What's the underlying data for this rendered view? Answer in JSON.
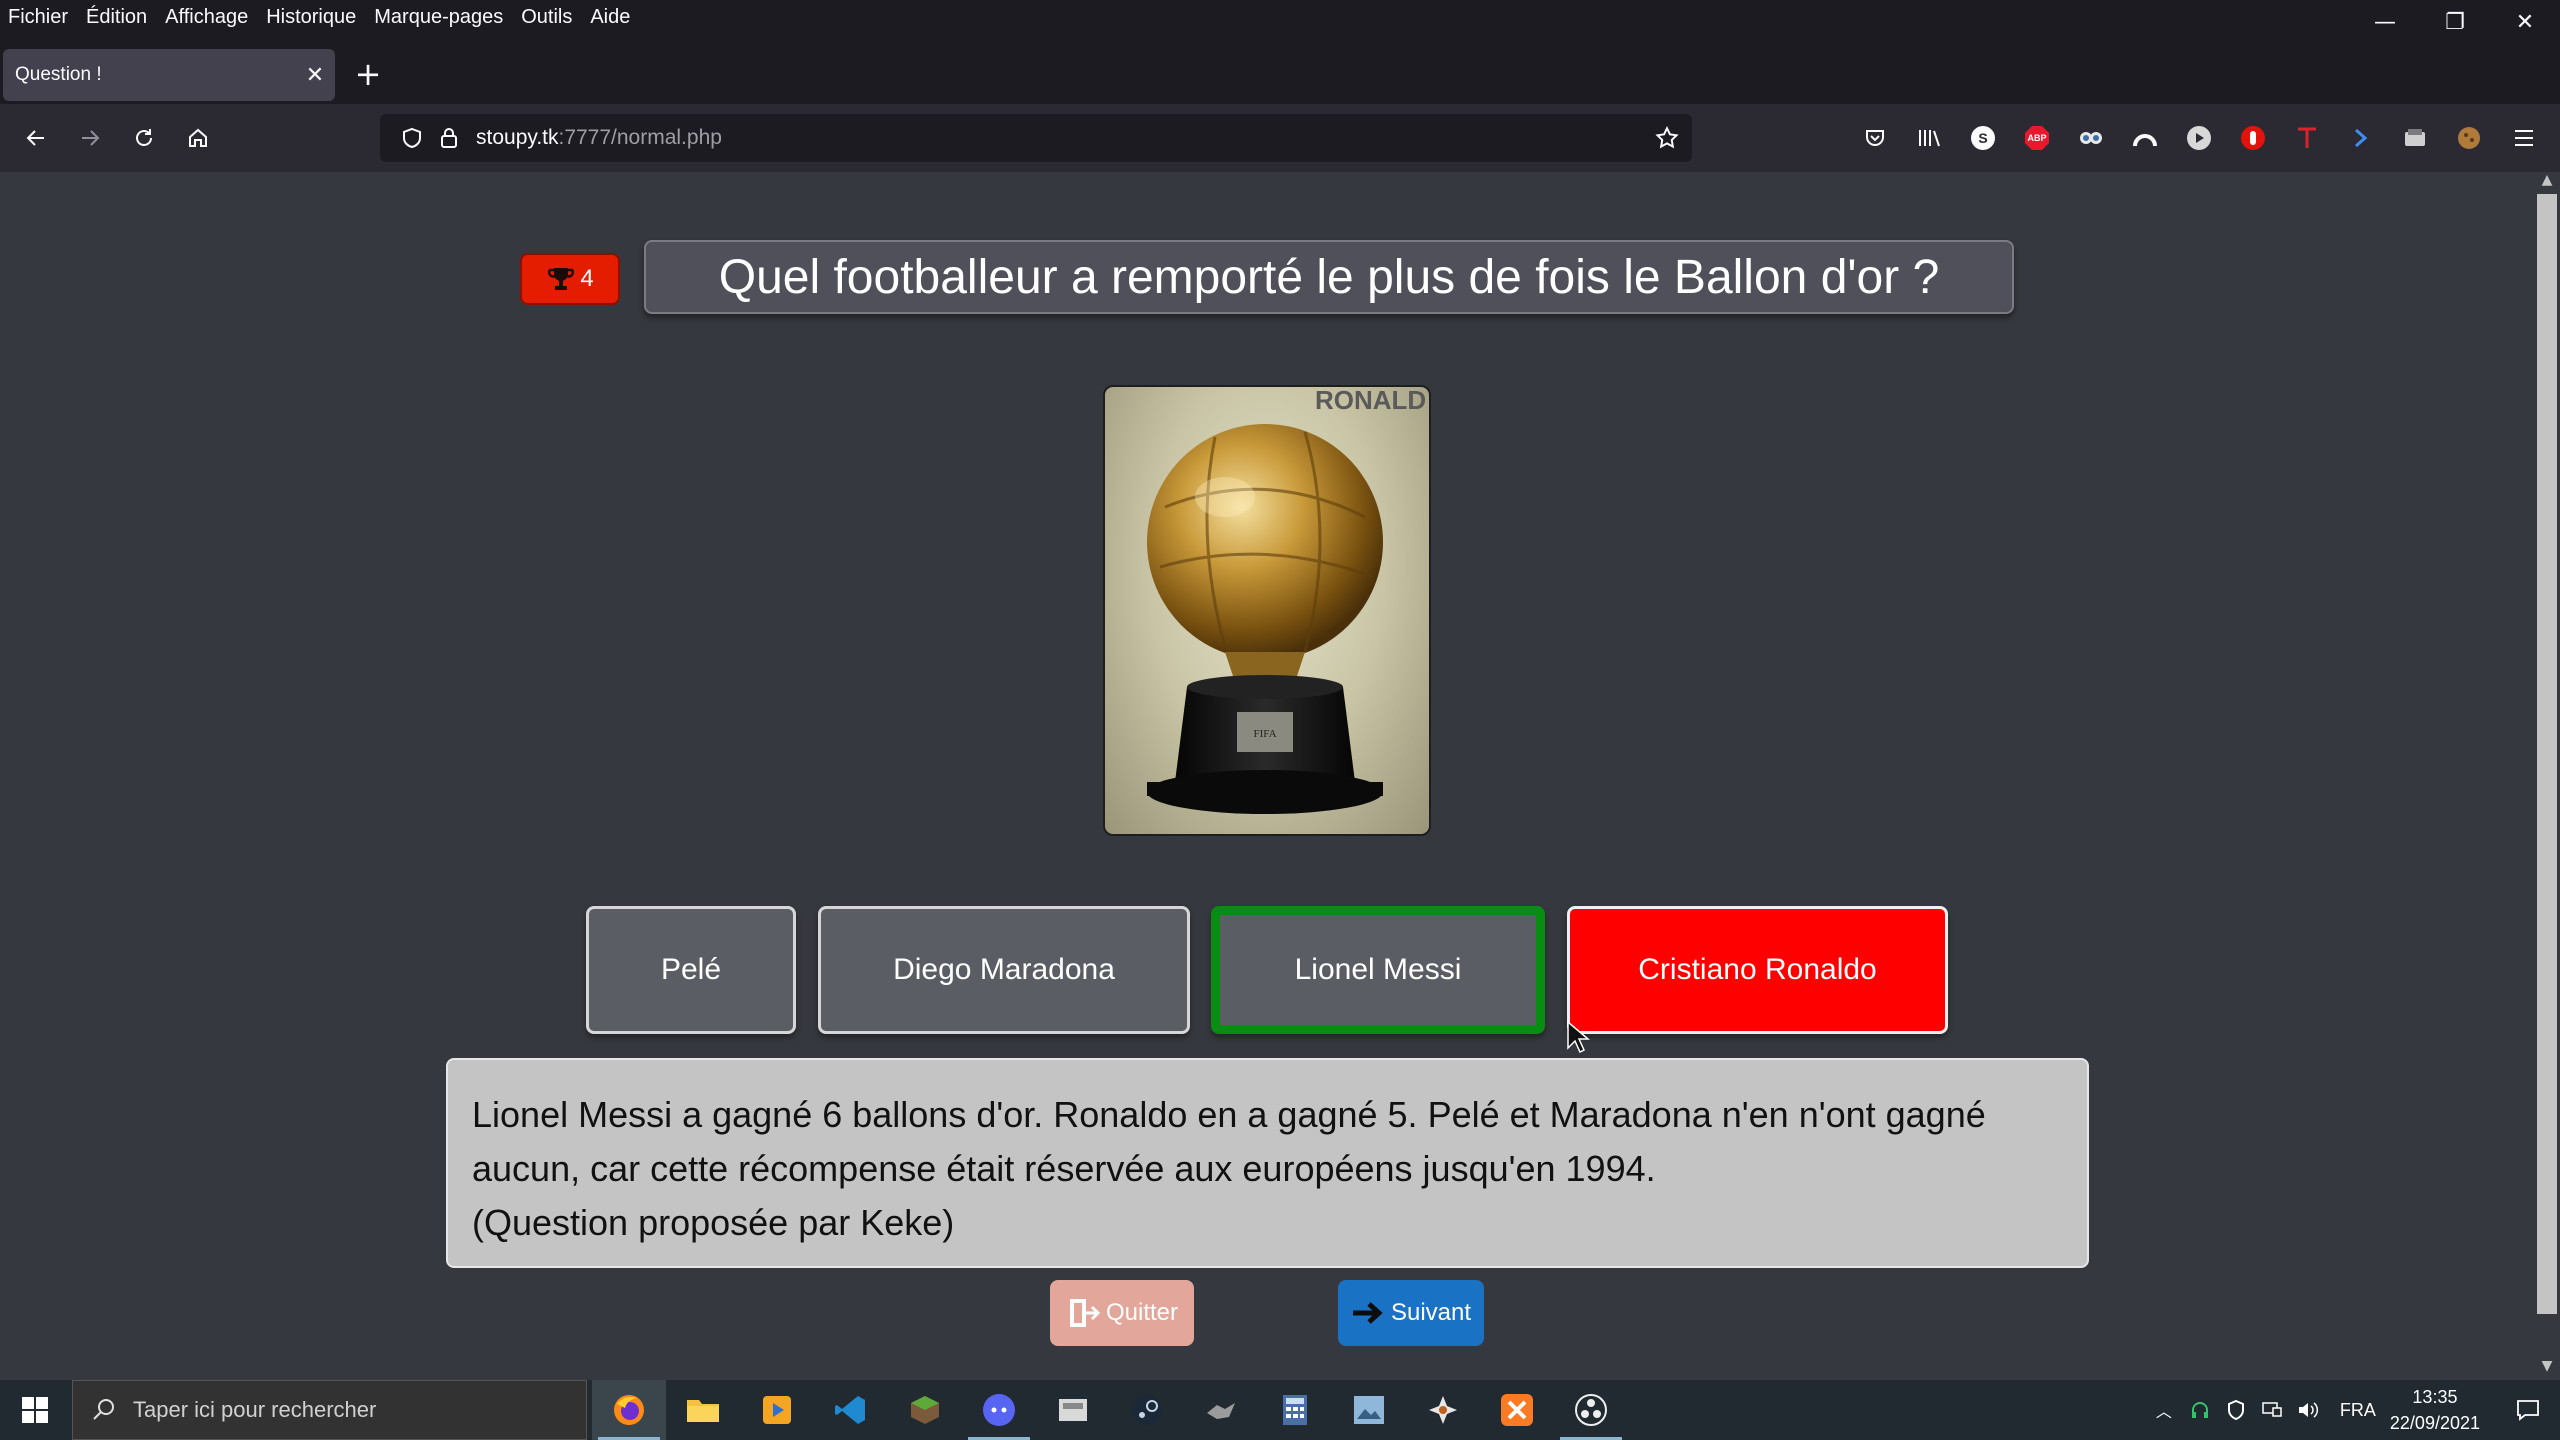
{
  "menubar": {
    "items": [
      "Fichier",
      "Édition",
      "Affichage",
      "Historique",
      "Marque-pages",
      "Outils",
      "Aide"
    ]
  },
  "window_controls": {
    "minimize": "—",
    "restore": "❐",
    "close": "✕"
  },
  "tabs": {
    "active_title": "Question !",
    "close_glyph": "✕",
    "new_tab_glyph": "+"
  },
  "navbar": {
    "url_host": "stoupy.tk",
    "url_rest": ":7777/normal.php",
    "extensions": [
      "pocket-icon",
      "library-icon",
      "skype-icon",
      "adblock-plus-icon",
      "extension-eyes-icon",
      "extension-arc-icon",
      "extension-play-icon",
      "extension-red-hand-icon",
      "extension-t-icon",
      "extension-arrow-icon",
      "extension-screenshot-icon",
      "extension-cookie-icon",
      "menu-icon"
    ]
  },
  "quiz": {
    "score": "4",
    "question": "Quel footballeur a remporté le plus de fois le Ballon d'or ?",
    "image_banner_text": "RONALD",
    "answers": [
      {
        "label": "Pelé",
        "state": "neutral"
      },
      {
        "label": "Diego Maradona",
        "state": "neutral"
      },
      {
        "label": "Lionel Messi",
        "state": "correct"
      },
      {
        "label": "Cristiano Ronaldo",
        "state": "wrong"
      }
    ],
    "explanation_lines": [
      "Lionel Messi a gagné 6 ballons d'or. Ronaldo en a gagné 5. Pelé et Maradona n'en n'ont gagné",
      "aucun, car cette récompense était réservée aux européens jusqu'en 1994.",
      "(Question proposée par Keke)"
    ],
    "quit_label": "Quitter",
    "next_label": "Suivant"
  },
  "colors": {
    "correct_border": "#078d12",
    "wrong_fill": "#ff0000",
    "score_badge": "#e51d00",
    "next_button": "#1a72c4",
    "quit_button": "#e2a79a"
  },
  "taskbar": {
    "search_placeholder": "Taper ici pour rechercher",
    "apps": [
      "firefox-icon",
      "file-explorer-icon",
      "media-player-icon",
      "vscode-icon",
      "minecraft-icon",
      "discord-icon",
      "cloud-app-icon",
      "steam-icon",
      "game-app-icon",
      "calculator-icon",
      "paint-app-icon",
      "puzzle-app-icon",
      "xampp-icon",
      "obs-icon"
    ],
    "language": "FRA",
    "time": "13:35",
    "date": "22/09/2021"
  }
}
